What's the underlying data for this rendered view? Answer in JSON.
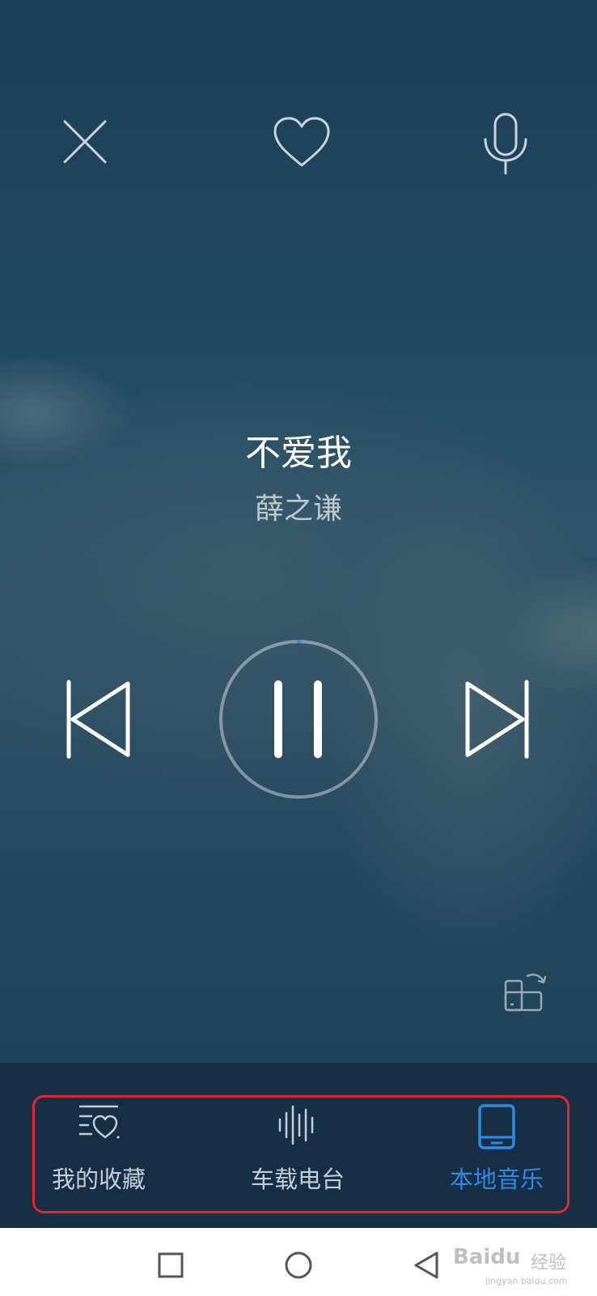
{
  "player": {
    "top_controls": {
      "close_icon": "close-icon",
      "favorite_icon": "heart-outline-icon",
      "voice_icon": "microphone-icon"
    },
    "song": {
      "title": "不爱我",
      "artist": "薛之谦"
    },
    "controls": {
      "previous_icon": "skip-previous-icon",
      "pause_icon": "pause-icon",
      "next_icon": "skip-next-icon",
      "switch_device_icon": "phone-switch-icon"
    },
    "playback_progress": 0.003
  },
  "bottom_nav": {
    "items": [
      {
        "label": "我的收藏",
        "icon": "favorites-list-icon",
        "active": false
      },
      {
        "label": "车载电台",
        "icon": "sound-wave-icon",
        "active": false
      },
      {
        "label": "本地音乐",
        "icon": "phone-icon",
        "active": true
      }
    ]
  },
  "system_nav": {
    "recent_icon": "square-icon",
    "home_icon": "circle-icon",
    "back_icon": "triangle-back-icon"
  },
  "watermark": {
    "brand": "Baidu",
    "brand_suffix": "经验",
    "url": "jingyan.baidu.com"
  },
  "colors": {
    "active": "#2d8ae6",
    "inactive_nav": "#c4ced8",
    "highlight_border": "#e52630",
    "nav_background": "#172f45"
  }
}
